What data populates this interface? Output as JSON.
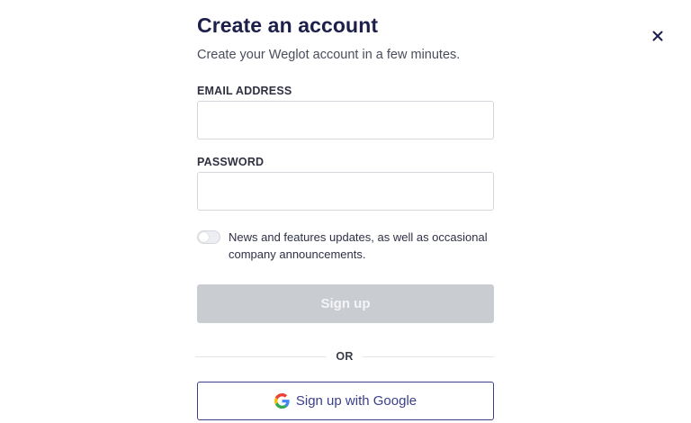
{
  "dialog": {
    "title": "Create an account",
    "subtitle": "Create your Weglot account in a few minutes.",
    "close_icon": "close-icon"
  },
  "form": {
    "email": {
      "label": "EMAIL ADDRESS",
      "value": "",
      "placeholder": ""
    },
    "password": {
      "label": "PASSWORD",
      "value": "",
      "placeholder": ""
    },
    "newsletter": {
      "checked": false,
      "text": "News and features updates, as well as occasional company announcements."
    },
    "signup_label": "Sign up",
    "divider_label": "OR",
    "google_label": "Sign up with Google",
    "google_icon": "google-icon"
  },
  "colors": {
    "title": "#1c1f4a",
    "signup_disabled_bg": "#c9ccd1",
    "google_accent": "#3b3f8a"
  }
}
